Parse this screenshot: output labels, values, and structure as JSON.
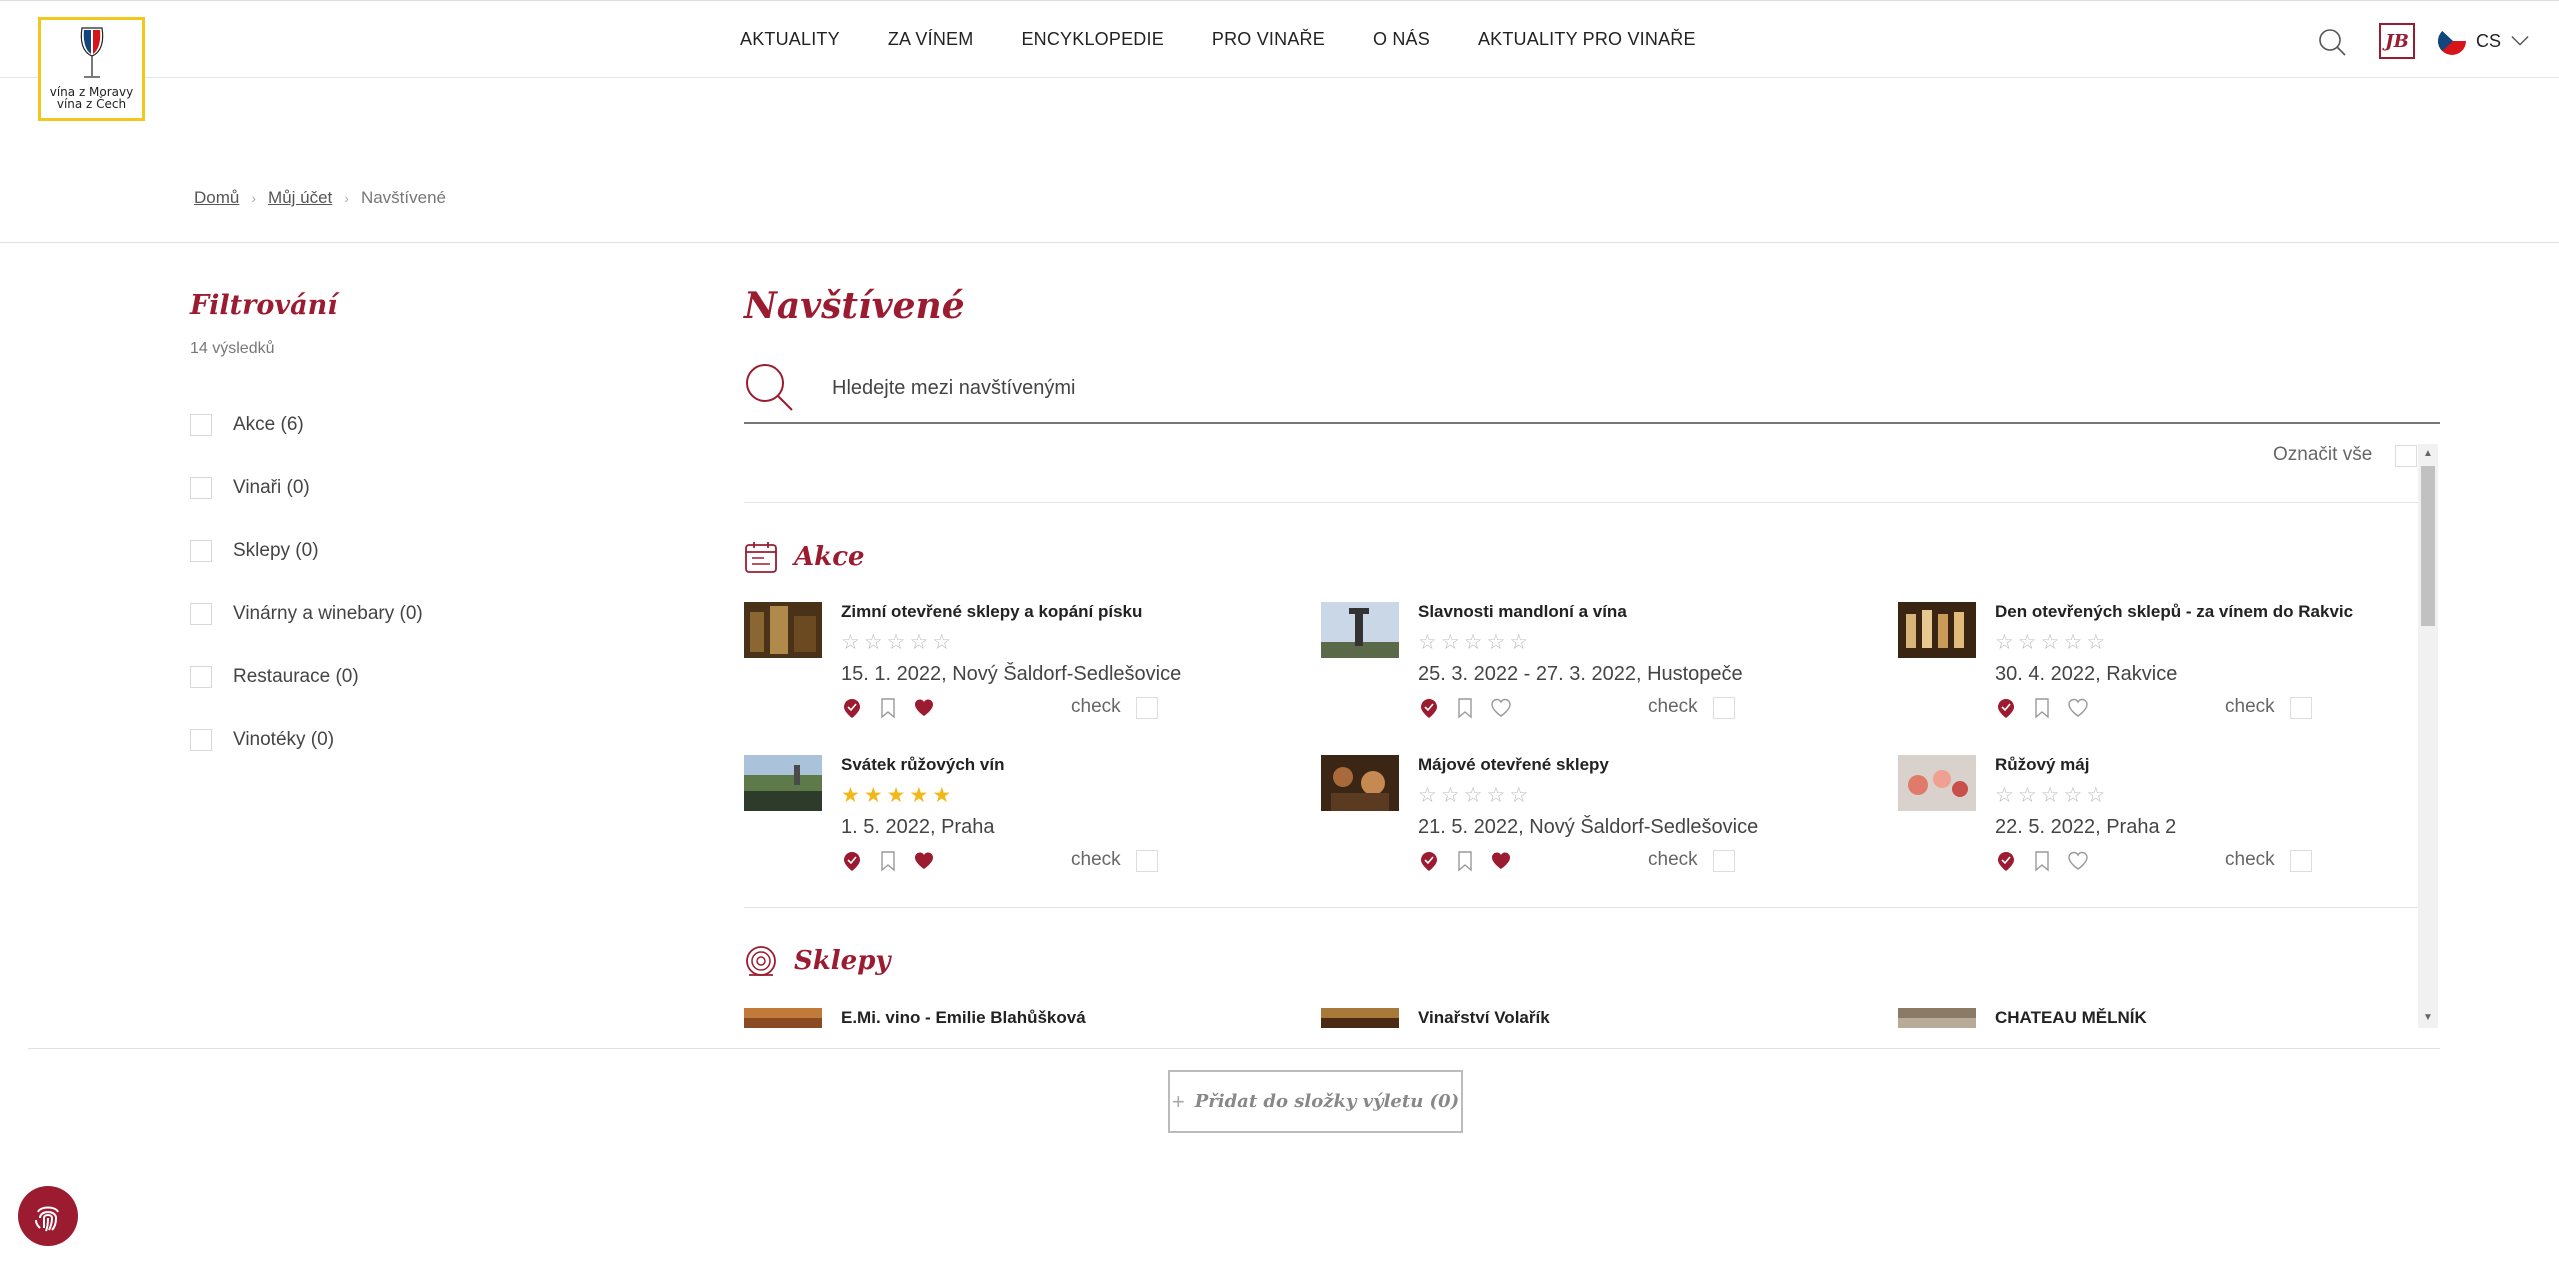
{
  "header": {
    "logo_line1": "vína z Moravy",
    "logo_line2": "vína z Čech",
    "nav": [
      "AKTUALITY",
      "ZA VÍNEM",
      "ENCYKLOPEDIE",
      "PRO VINAŘE",
      "O NÁS",
      "AKTUALITY PRO VINAŘE"
    ],
    "user_initials": "JB",
    "lang": "CS"
  },
  "breadcrumb": {
    "home": "Domů",
    "account": "Můj účet",
    "current": "Navštívené"
  },
  "sidebar": {
    "title": "Filtrování",
    "count": "14 výsledků",
    "items": [
      {
        "label": "Akce (6)"
      },
      {
        "label": "Vinaři (0)"
      },
      {
        "label": "Sklepy (0)"
      },
      {
        "label": "Vinárny a winebary (0)"
      },
      {
        "label": "Restaurace (0)"
      },
      {
        "label": "Vinotéky (0)"
      }
    ]
  },
  "main": {
    "title": "Navštívené",
    "search_placeholder": "Hledejte mezi navštívenými",
    "mark_all": "Označit vše",
    "check_label": "check",
    "sections": [
      {
        "title": "Akce",
        "icon": "calendar-icon",
        "cards": [
          {
            "title": "Zimní otevřené sklepy a kopání písku",
            "rating": 0,
            "meta": "15. 1. 2022, Nový Šaldorf-Sedlešovice",
            "favorite": true
          },
          {
            "title": "Slavnosti mandloní a vína",
            "rating": 0,
            "meta": "25. 3. 2022 - 27. 3. 2022, Hustopeče",
            "favorite": false
          },
          {
            "title": "Den otevřených sklepů - za vínem do Rakvic",
            "rating": 0,
            "meta": "30. 4. 2022, Rakvice",
            "favorite": false
          },
          {
            "title": "Svátek růžových vín",
            "rating": 5,
            "meta": "1. 5. 2022, Praha",
            "favorite": true
          },
          {
            "title": "Májové otevřené sklepy",
            "rating": 0,
            "meta": "21. 5. 2022, Nový Šaldorf-Sedlešovice",
            "favorite": true
          },
          {
            "title": "Růžový máj",
            "rating": 0,
            "meta": "22. 5. 2022, Praha 2",
            "favorite": false
          }
        ]
      },
      {
        "title": "Sklepy",
        "icon": "barrel-icon",
        "cards": [
          {
            "title": "E.Mi. vino - Emilie Blahůšková"
          },
          {
            "title": "Vinařství Volařík"
          },
          {
            "title": "CHATEAU MĚLNÍK"
          }
        ]
      }
    ]
  },
  "footer": {
    "add_button": "Přidat do složky výletu (0)",
    "add_plus": "+"
  },
  "colors": {
    "accent": "#9b1b30",
    "star": "#f2b817",
    "logo_border": "#f1c81b"
  }
}
